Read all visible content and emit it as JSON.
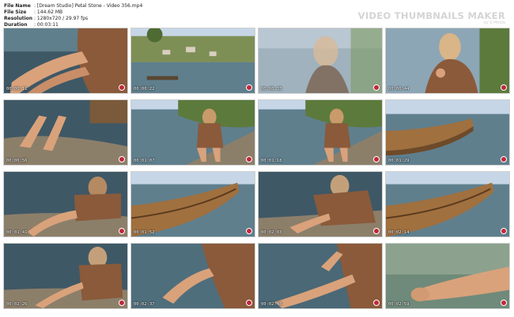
{
  "header": {
    "rows": [
      {
        "label": "File Name",
        "value": ": [Dream Studio] Petal Stone - Video 356.mp4"
      },
      {
        "label": "File Size",
        "value": ": 144.62 MB"
      },
      {
        "label": "Resolution",
        "value": ": 1280x720 / 29.97 fps"
      },
      {
        "label": "Duration",
        "value": ": 00:03:11"
      }
    ],
    "brand": "VIDEO THUMBNAILS MAKER",
    "brand_sub": "by IJ Media"
  },
  "thumbnails": [
    {
      "time": "00:00:11",
      "scene": "legs-dress-water"
    },
    {
      "time": "00:00:22",
      "scene": "village-landscape"
    },
    {
      "time": "00:00:33",
      "scene": "woman-faded-water"
    },
    {
      "time": "00:00:44",
      "scene": "woman-sitting-water"
    },
    {
      "time": "00:00:56",
      "scene": "feet-rocks"
    },
    {
      "time": "00:01:07",
      "scene": "woman-kneeling-shore"
    },
    {
      "time": "00:01:18",
      "scene": "woman-kneeling-shore"
    },
    {
      "time": "00:01:29",
      "scene": "wooden-boat"
    },
    {
      "time": "00:01:41",
      "scene": "woman-lying-rocks"
    },
    {
      "time": "00:01:52",
      "scene": "wooden-boat-close"
    },
    {
      "time": "00:02:03",
      "scene": "woman-crouching-rocks"
    },
    {
      "time": "00:02:14",
      "scene": "wooden-boat-close"
    },
    {
      "time": "00:02:26",
      "scene": "woman-reaching-water"
    },
    {
      "time": "00:02:37",
      "scene": "arm-over-water"
    },
    {
      "time": "00:02:48",
      "scene": "legs-over-water"
    },
    {
      "time": "00:02:59",
      "scene": "foot-in-water"
    }
  ],
  "palette": {
    "water": "#5f7f8d",
    "water_dark": "#3f5866",
    "sky": "#c6d6e6",
    "skin": "#d9a27b",
    "dress": "#8a5a3a",
    "rock": "#8c7f6a",
    "boat": "#a0703f",
    "grass": "#5c7a3c",
    "watermark": "#c0283a"
  }
}
